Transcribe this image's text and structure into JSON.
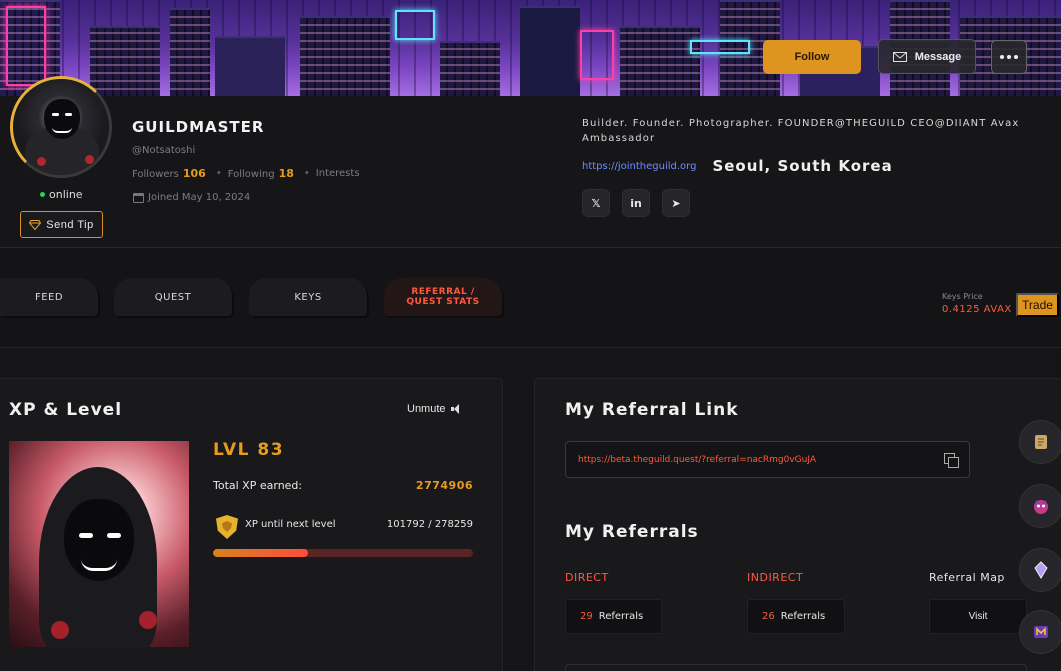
{
  "header": {
    "follow_label": "Follow",
    "message_label": "Message"
  },
  "profile": {
    "username": "GUILDMASTER",
    "handle": "@Notsatoshi",
    "followers_label": "Followers",
    "followers_count": "106",
    "following_label": "Following",
    "following_count": "18",
    "interests_label": "Interests",
    "joined": "Joined May 10, 2024",
    "status": "online",
    "send_tip_label": "Send Tip",
    "bio": "Builder. Founder. Photographer. FOUNDER@THEGUILD CEO@DIIANT Avax Ambassador",
    "website": "https://jointheguild.org",
    "location": "Seoul, South Korea",
    "socials": [
      {
        "label": "𝕏",
        "icon": "x-icon"
      },
      {
        "label": "in",
        "icon": "linkedin-icon"
      },
      {
        "label": "➤",
        "icon": "telegram-icon"
      }
    ]
  },
  "tabs": [
    {
      "label": "FEED"
    },
    {
      "label": "QUEST"
    },
    {
      "label": "KEYS"
    },
    {
      "label": "REFERRAL /\nQUEST STATS"
    }
  ],
  "keys": {
    "price_label": "Keys Price",
    "price_value": "0.4125 AVAX",
    "trade_label": "Trade"
  },
  "xp_panel": {
    "title": "XP & Level",
    "unmute_label": "Unmute",
    "level": "LVL 83",
    "total_label": "Total XP earned:",
    "total_value": "2774906",
    "next_label": "XP until next level",
    "next_value": "101792 / 278259",
    "progress_fraction": 0.366
  },
  "referral": {
    "title": "My Referral Link",
    "link": "https://beta.theguild.quest/?referral=nacRmg0vGuJA",
    "my_referrals_title": "My Referrals",
    "direct_label": "DIRECT",
    "direct_count": "29",
    "indirect_label": "INDIRECT",
    "indirect_count": "26",
    "referrals_word": "Referrals",
    "map_label": "Referral Map",
    "visit_label": "Visit"
  },
  "colors": {
    "accent": "#dd951f",
    "highlight": "#ff5a3d",
    "link": "#6f8cff"
  }
}
